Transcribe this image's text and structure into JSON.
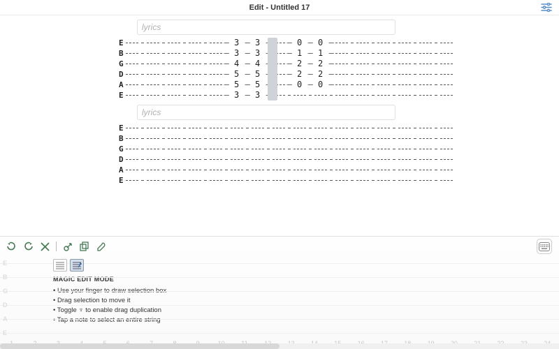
{
  "header": {
    "title": "Edit - Untitled 17"
  },
  "strings": [
    "E",
    "B",
    "G",
    "D",
    "A",
    "E"
  ],
  "lyrics_placeholder": "lyrics",
  "columns": 16,
  "section1": {
    "selected_col": 8,
    "frets": {
      "E": {
        "5": "3",
        "6": "3",
        "8": "0",
        "9": "0"
      },
      "B": {
        "5": "3",
        "6": "3",
        "8": "1",
        "9": "1"
      },
      "G": {
        "5": "4",
        "6": "4",
        "8": "2",
        "9": "2"
      },
      "D": {
        "5": "5",
        "6": "5",
        "8": "2",
        "9": "2"
      },
      "A": {
        "5": "5",
        "6": "5",
        "8": "0",
        "9": "0"
      },
      "E2": {
        "5": "3",
        "6": "3"
      }
    }
  },
  "section2": {
    "frets": {}
  },
  "help": {
    "title": "MAGIC EDIT MODE",
    "lines": [
      "Use your finger to draw selection box",
      "Drag selection to move it",
      "Toggle ♆ to enable drag duplication",
      "Tap a note to select an entire string"
    ]
  },
  "fret_numbers": 24
}
